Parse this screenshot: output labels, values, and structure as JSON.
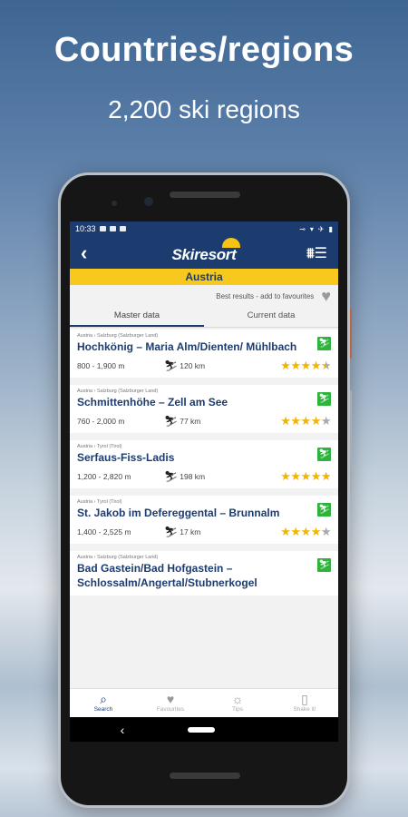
{
  "promo": {
    "headline": "Countries/regions",
    "subheadline": "2,200 ski regions"
  },
  "status_bar": {
    "time": "10:33"
  },
  "app_bar": {
    "back_icon": "arrow-left-icon",
    "logo_text": "Skiresort",
    "filter_icon": "filter-list-icon"
  },
  "country_banner": "Austria",
  "favourites_hint": "Best results - add to favourites",
  "tabs": [
    {
      "label": "Master data",
      "active": true
    },
    {
      "label": "Current data",
      "active": false
    }
  ],
  "resorts": [
    {
      "location": "Austria › Salzburg (Salzburger Land)",
      "name": "Hochkönig – Maria Alm/Dienten/ Mühlbach",
      "altitude": "800 - 1,900 m",
      "slopes": "120 km",
      "rating": 4.5
    },
    {
      "location": "Austria › Salzburg (Salzburger Land)",
      "name": "Schmittenhöhe – Zell am See",
      "altitude": "760 - 2,000 m",
      "slopes": "77 km",
      "rating": 4
    },
    {
      "location": "Austria › Tyrol (Tirol)",
      "name": "Serfaus-Fiss-Ladis",
      "altitude": "1,200 - 2,820 m",
      "slopes": "198 km",
      "rating": 5
    },
    {
      "location": "Austria › Tyrol (Tirol)",
      "name": "St. Jakob im Defereggental – Brunnalm",
      "altitude": "1,400 - 2,525 m",
      "slopes": "17 km",
      "rating": 4
    },
    {
      "location": "Austria › Salzburg (Salzburger Land)",
      "name": "Bad Gastein/Bad Hofgastein – Schlossalm/Angertal/Stubnerkogel",
      "altitude": "",
      "slopes": "",
      "rating": null
    }
  ],
  "bottom_nav": [
    {
      "label": "Search",
      "icon": "search-icon",
      "active": true
    },
    {
      "label": "Favourites",
      "icon": "heart-icon",
      "active": false
    },
    {
      "label": "Tips",
      "icon": "lightbulb-icon",
      "active": false
    },
    {
      "label": "Shake it!",
      "icon": "shake-phone-icon",
      "active": false
    }
  ],
  "colors": {
    "primary": "#1c3c6f",
    "accent": "#f7c91e",
    "star": "#f2b400",
    "badge": "#2eb33c"
  }
}
